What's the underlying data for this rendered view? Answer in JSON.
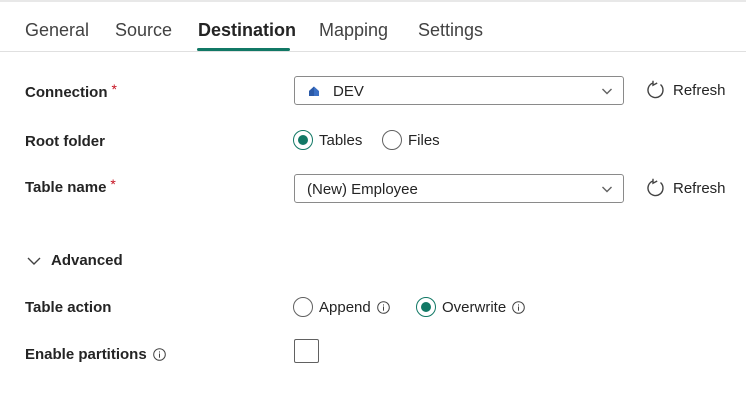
{
  "tabs": [
    {
      "label": "General"
    },
    {
      "label": "Source"
    },
    {
      "label": "Destination",
      "active": true
    },
    {
      "label": "Mapping"
    },
    {
      "label": "Settings"
    }
  ],
  "connection": {
    "label": "Connection",
    "required_mark": "*",
    "value": "DEV",
    "refresh_label": "Refresh"
  },
  "root_folder": {
    "label": "Root folder",
    "options": [
      {
        "label": "Tables",
        "checked": true
      },
      {
        "label": "Files",
        "checked": false
      }
    ]
  },
  "table_name": {
    "label": "Table name",
    "required_mark": "*",
    "value": "(New) Employee",
    "refresh_label": "Refresh"
  },
  "advanced": {
    "label": "Advanced",
    "expanded": true
  },
  "table_action": {
    "label": "Table action",
    "options": [
      {
        "label": "Append",
        "checked": false
      },
      {
        "label": "Overwrite",
        "checked": true
      }
    ]
  },
  "enable_partitions": {
    "label": "Enable partitions",
    "checked": false
  },
  "colors": {
    "accent": "#117865",
    "required": "#c50f1f",
    "connection_icon": "#3a6fc4"
  },
  "icons": {
    "refresh": "refresh-icon",
    "chevron": "chevron-down-icon",
    "info": "info-icon",
    "connection": "database-icon"
  }
}
